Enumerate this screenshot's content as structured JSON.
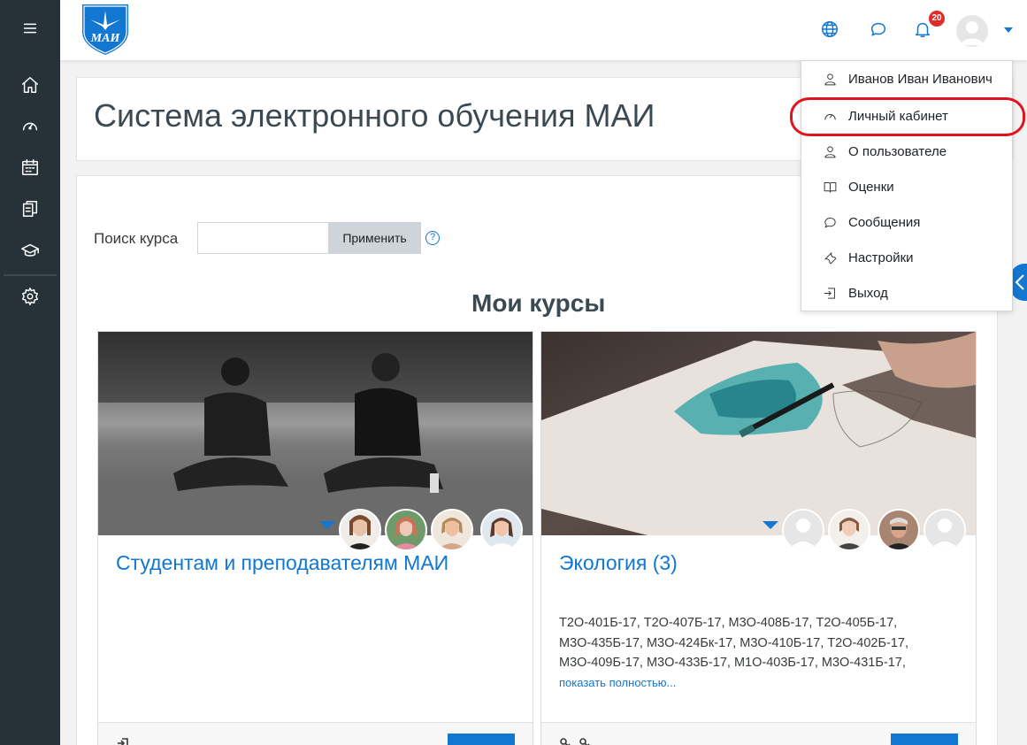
{
  "app": {
    "logo_text": "МАИ",
    "page_title": "Система электронного обучения МАИ"
  },
  "topbar": {
    "notification_count": "20"
  },
  "sidebar": {
    "items": [
      {
        "name": "menu-icon"
      },
      {
        "name": "home-icon"
      },
      {
        "name": "dashboard-icon"
      },
      {
        "name": "calendar-icon"
      },
      {
        "name": "files-icon"
      },
      {
        "name": "courses-icon"
      },
      {
        "name": "settings-icon"
      }
    ]
  },
  "search": {
    "label": "Поиск курса",
    "value": "",
    "button_label": "Применить",
    "help_symbol": "?"
  },
  "main": {
    "section_title": "Мои курсы"
  },
  "courses": [
    {
      "title": "Студентам и преподавателям МАИ",
      "description": "",
      "show_more": ""
    },
    {
      "title": "Экология (3)",
      "description": "Т2О-401Б-17, Т2О-407Б-17, М3О-408Б-17, Т2О-405Б-17, М3О-435Б-17, М3О-424Бк-17, М3О-410Б-17, Т2О-402Б-17, М3О-409Б-17, М3О-433Б-17, М1О-403Б-17, М3О-431Б-17,",
      "show_more": "показать полностью..."
    }
  ],
  "user_menu": {
    "items": [
      {
        "label": "Иванов Иван Иванович",
        "icon": "user-icon"
      },
      {
        "label": "Личный кабинет",
        "icon": "dashboard-icon"
      },
      {
        "label": "О пользователе",
        "icon": "user-icon"
      },
      {
        "label": "Оценки",
        "icon": "grades-icon"
      },
      {
        "label": "Сообщения",
        "icon": "message-icon"
      },
      {
        "label": "Настройки",
        "icon": "wrench-icon"
      },
      {
        "label": "Выход",
        "icon": "logout-icon"
      }
    ],
    "highlighted_item": "Личный кабинет"
  },
  "colors": {
    "accent": "#1177d1",
    "sidebar": "#263238",
    "highlight": "#e0141a",
    "badge": "#e12a2a"
  }
}
